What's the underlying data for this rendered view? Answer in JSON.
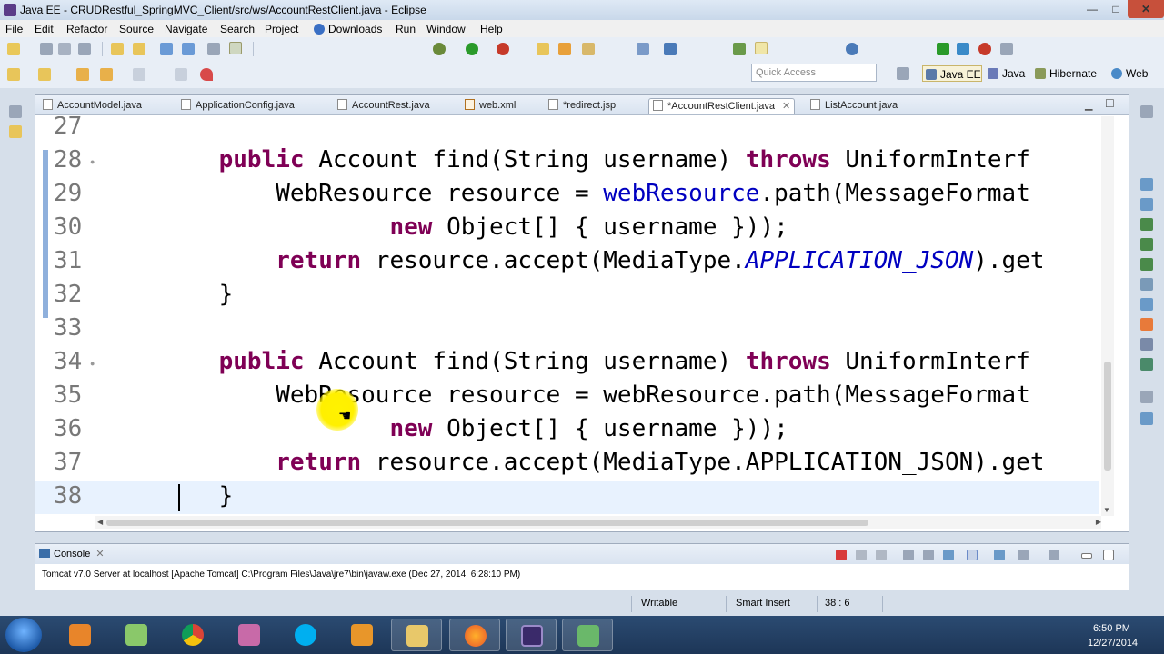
{
  "window": {
    "title": "Java EE - CRUDRestful_SpringMVC_Client/src/ws/AccountRestClient.java - Eclipse",
    "minimize": "—",
    "maximize": "□",
    "close": "✕"
  },
  "menu": [
    "File",
    "Edit",
    "Refactor",
    "Source",
    "Navigate",
    "Search",
    "Project",
    "Downloads",
    "Run",
    "Window",
    "Help"
  ],
  "quick_access": {
    "placeholder": "Quick Access"
  },
  "perspectives": [
    "Java EE",
    "Java",
    "Hibernate",
    "Web"
  ],
  "editor_tabs": [
    {
      "label": "AccountModel.java",
      "icon": "java-file-icon",
      "active": false
    },
    {
      "label": "ApplicationConfig.java",
      "icon": "java-file-icon",
      "active": false
    },
    {
      "label": "AccountRest.java",
      "icon": "java-file-icon",
      "active": false
    },
    {
      "label": "web.xml",
      "icon": "xml-file-icon",
      "active": false
    },
    {
      "label": "*redirect.jsp",
      "icon": "jsp-file-icon",
      "active": false
    },
    {
      "label": "*AccountRestClient.java",
      "icon": "java-file-icon",
      "active": true
    },
    {
      "label": "ListAccount.java",
      "icon": "java-file-icon",
      "active": false
    }
  ],
  "tab_close_glyph": "✕",
  "code_lines": [
    {
      "num": "27",
      "code": ""
    },
    {
      "num": "28",
      "code": "    public Account find(String username) throws UniformInterf"
    },
    {
      "num": "29",
      "code": "        WebResource resource = webResource.path(MessageFormat"
    },
    {
      "num": "30",
      "code": "                new Object[] { username }));"
    },
    {
      "num": "31",
      "code": "        return resource.accept(MediaType.APPLICATION_JSON).get"
    },
    {
      "num": "32",
      "code": "    }"
    },
    {
      "num": "33",
      "code": ""
    },
    {
      "num": "34",
      "code": "    public Account find(String username) throws UniformInterf"
    },
    {
      "num": "35",
      "code": "        WebResource resource = webResource.path(MessageFormat"
    },
    {
      "num": "36",
      "code": "                new Object[] { username }));"
    },
    {
      "num": "37",
      "code": "        return resource.accept(MediaType.APPLICATION_JSON).get"
    },
    {
      "num": "38",
      "code": "    }"
    }
  ],
  "console": {
    "tab_label": "Console",
    "description": "Tomcat v7.0 Server at localhost [Apache Tomcat] C:\\Program Files\\Java\\jre7\\bin\\javaw.exe (Dec 27, 2014, 6:28:10 PM)"
  },
  "status": {
    "writable": "Writable",
    "insert_mode": "Smart Insert",
    "position": "38 : 6"
  },
  "taskbar": {
    "apps": [
      "media-player-icon",
      "file-explorer-icon",
      "chrome-icon",
      "paint-icon",
      "skype-icon",
      "outlook-icon",
      "folder-icon",
      "firefox-icon",
      "eclipse-icon",
      "notepad-icon"
    ],
    "time": "6:50 PM",
    "date": "12/27/2014"
  },
  "colors": {
    "keyword": "#7f0055",
    "field": "#0000c0",
    "line_number": "#787878",
    "current_line": "#e8f2fe"
  }
}
